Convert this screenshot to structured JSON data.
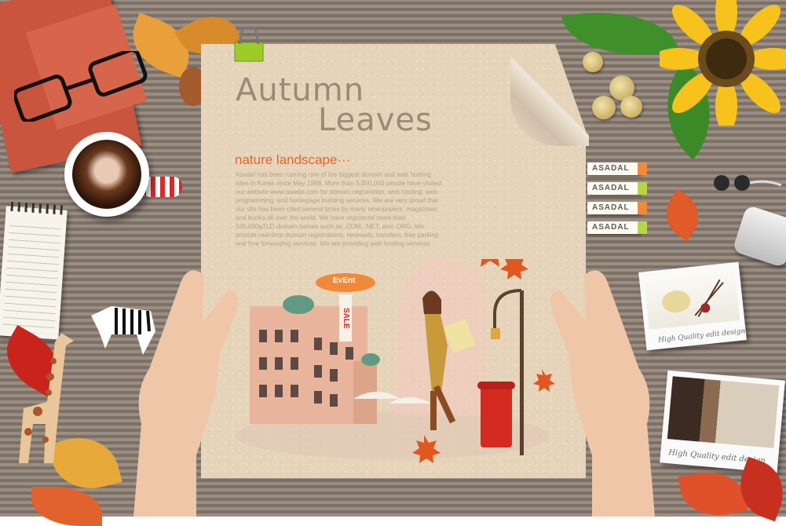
{
  "paper": {
    "title_line1": "Autumn",
    "title_line2": "Leaves",
    "subtitle": "nature landscape···",
    "body": "Asadal has been running one of the biggest domain and web hosting sites in Korea since May 1998. More than 3,000,000 people have visited our website www.asadal.com for domain registration, web hosting, web programming, and homepage building services. We are very proud that our site has been cited several times by many newspapers, magazines, and books all over the world. We have registered more than 100,000gTLD domain names such as .COM, .NET, and .ORG. We provide real-time domain registrations, renewals, transfers, free parking and free forwarding services. We are providing web hosting services."
  },
  "illustration": {
    "blimp_label": "EvEnt",
    "banner_label": "SALE"
  },
  "tags": [
    "ASADAL",
    "ASADAL",
    "ASADAL",
    "ASADAL"
  ],
  "tag_colors": [
    "#f08a3a",
    "#b8d54a",
    "#f08a3a",
    "#b8d54a"
  ],
  "photos": {
    "caption1": "High Quality edit design",
    "caption2": "High Quality edit design"
  },
  "colors": {
    "accent_orange": "#e8632c",
    "title_brown": "#9b8a78",
    "paper": "#e6d4ba"
  },
  "icons": [
    "book",
    "glasses",
    "coffee-cup",
    "notebook",
    "zebra-toy",
    "giraffe-toy",
    "paper-clip",
    "sunflower",
    "coins",
    "earphones",
    "mp3-player",
    "maple-leaf"
  ]
}
